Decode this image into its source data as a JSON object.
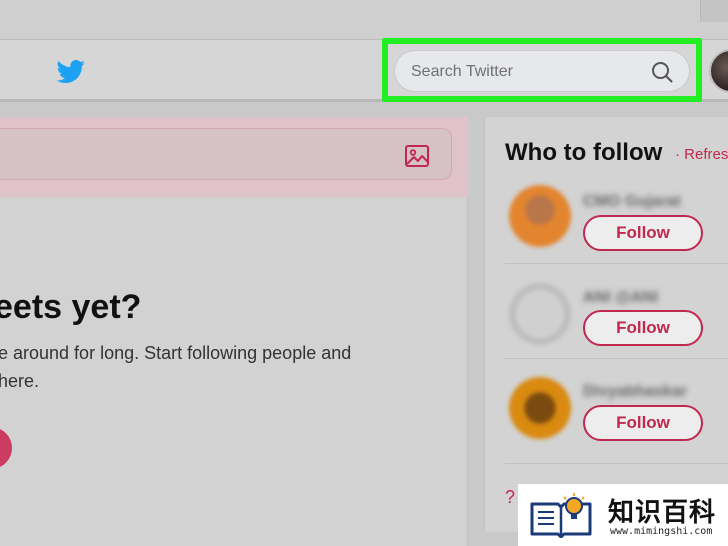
{
  "header": {
    "search_placeholder": "Search Twitter"
  },
  "main": {
    "empty_heading": "eets yet?",
    "empty_line1": "e around for long. Start following people and",
    "empty_line2": "here."
  },
  "sidebar": {
    "title": "Who to follow",
    "refresh": "· Refresh",
    "suggestions": [
      {
        "name": "CMO Gujarat",
        "follow_label": "Follow",
        "avatar_color": "#e3852e"
      },
      {
        "name": "ANI @ANI",
        "follow_label": "Follow",
        "avatar_color": "#bfbfbf"
      },
      {
        "name": "Divyabhaskar",
        "follow_label": "Follow",
        "avatar_color": "#d98a10"
      }
    ],
    "footer_link": "?"
  },
  "watermark": {
    "title": "知识百科",
    "url": "www.mimingshi.com"
  },
  "colors": {
    "highlight": "#22ee22",
    "accent": "#c0284f",
    "twitter_blue": "#1da1f2"
  }
}
